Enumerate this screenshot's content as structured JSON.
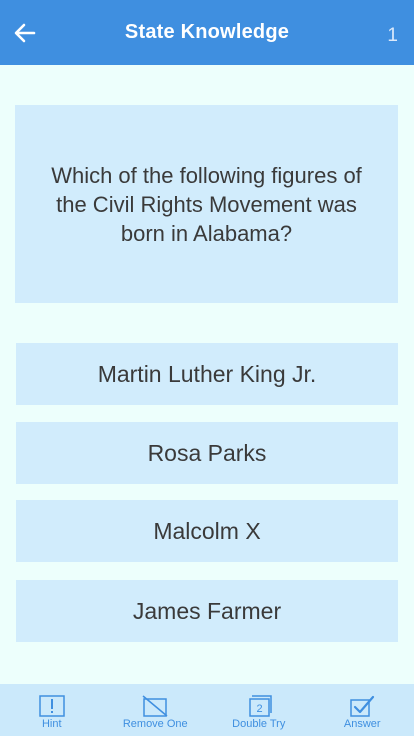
{
  "header": {
    "title": "State Knowledge",
    "counter": "1",
    "back_icon": "arrow-left-icon"
  },
  "question": {
    "text": "Which of the following figures of the Civil Rights Movement was born in Alabama?"
  },
  "answers": [
    {
      "label": "Martin Luther King Jr."
    },
    {
      "label": "Rosa Parks"
    },
    {
      "label": "Malcolm X"
    },
    {
      "label": "James Farmer"
    }
  ],
  "toolbar": {
    "items": [
      {
        "label": "Hint",
        "icon": "exclamation-icon"
      },
      {
        "label": "Remove One",
        "icon": "crossed-box-icon"
      },
      {
        "label": "Double Try",
        "icon": "number-two-box-icon"
      },
      {
        "label": "Answer",
        "icon": "checkbox-check-icon"
      }
    ]
  },
  "colors": {
    "header_bg": "#3f8fe0",
    "page_bg": "#edfffc",
    "card_bg": "#d1ecfc",
    "toolbar_bg": "#cbe9fb",
    "toolbar_accent": "#3f8fe0"
  }
}
